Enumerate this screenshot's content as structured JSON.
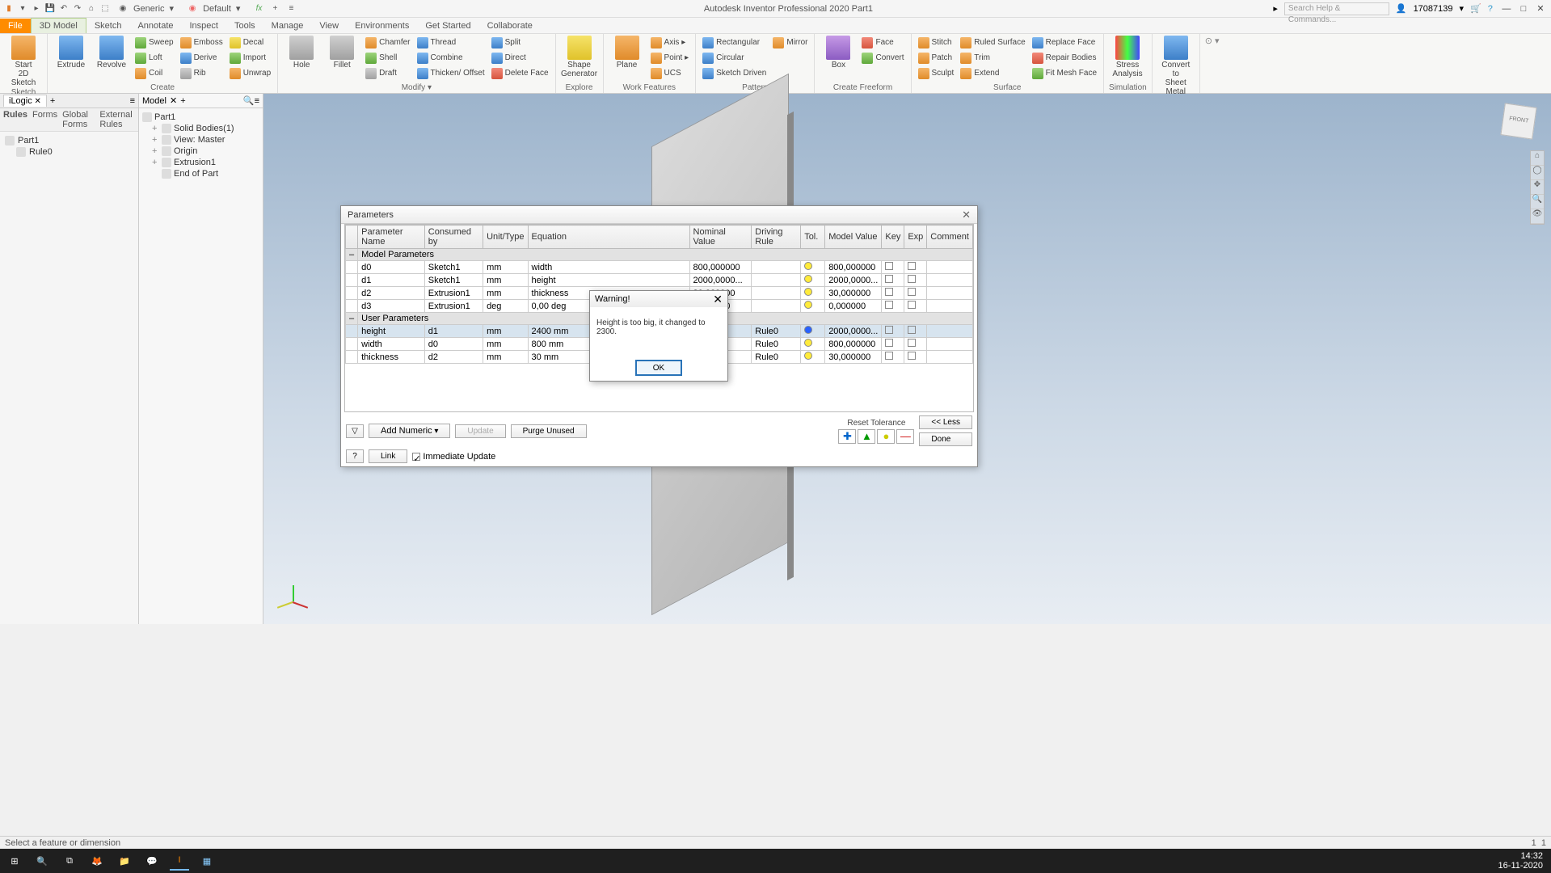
{
  "titlebar": {
    "material": "Generic",
    "appearance": "Default",
    "title": "Autodesk Inventor Professional 2020   Part1",
    "search_placeholder": "Search Help & Commands...",
    "user": "17087139"
  },
  "ribbon": {
    "tabs": [
      "File",
      "3D Model",
      "Sketch",
      "Annotate",
      "Inspect",
      "Tools",
      "Manage",
      "View",
      "Environments",
      "Get Started",
      "Collaborate"
    ],
    "active_tab": "3D Model",
    "groups": {
      "sketch": {
        "label": "Sketch",
        "start": "Start",
        "start2": "2D Sketch"
      },
      "create": {
        "label": "Create",
        "extrude": "Extrude",
        "revolve": "Revolve",
        "sweep": "Sweep",
        "loft": "Loft",
        "coil": "Coil",
        "emboss": "Emboss",
        "derive": "Derive",
        "rib": "Rib",
        "decal": "Decal",
        "import": "Import",
        "unwrap": "Unwrap"
      },
      "modify": {
        "label": "Modify ▾",
        "hole": "Hole",
        "fillet": "Fillet",
        "chamfer": "Chamfer",
        "shell": "Shell",
        "draft": "Draft",
        "thread": "Thread",
        "combine": "Combine",
        "thicken": "Thicken/ Offset",
        "split": "Split",
        "direct": "Direct",
        "delface": "Delete Face"
      },
      "explore": {
        "label": "Explore",
        "shape": "Shape",
        "gen": "Generator"
      },
      "workfeat": {
        "label": "Work Features",
        "plane": "Plane",
        "axis": "Axis  ▸",
        "point": "Point  ▸",
        "ucs": "UCS"
      },
      "pattern": {
        "label": "Pattern",
        "rect": "Rectangular",
        "circ": "Circular",
        "sketch": "Sketch Driven",
        "mirror": "Mirror"
      },
      "freeform": {
        "label": "Create Freeform",
        "box": "Box",
        "face": "Face",
        "convert": "Convert"
      },
      "surface": {
        "label": "Surface",
        "stitch": "Stitch",
        "patch": "Patch",
        "sculpt": "Sculpt",
        "ruled": "Ruled Surface",
        "trim": "Trim",
        "extend": "Extend",
        "replace": "Replace Face",
        "repair": "Repair Bodies",
        "fitmesh": "Fit Mesh Face"
      },
      "sim": {
        "label": "Simulation",
        "stress": "Stress",
        "analysis": "Analysis"
      },
      "convert": {
        "label": "Convert",
        "convto": "Convert to",
        "sheetm": "Sheet Metal"
      }
    }
  },
  "ilogic": {
    "tab": "iLogic",
    "subtabs": [
      "Rules",
      "Forms",
      "Global Forms",
      "External Rules"
    ],
    "tree": {
      "part": "Part1",
      "rule": "Rule0"
    }
  },
  "model": {
    "tab": "Model",
    "root": "Part1",
    "nodes": [
      "Solid Bodies(1)",
      "View: Master",
      "Origin",
      "Extrusion1",
      "End of Part"
    ]
  },
  "doctab": {
    "name": "Part1"
  },
  "status": {
    "prompt": "Select a feature or dimension",
    "r1": "1",
    "r2": "1"
  },
  "params": {
    "title": "Parameters",
    "headers": [
      "Parameter Name",
      "Consumed by",
      "Unit/Type",
      "Equation",
      "Nominal Value",
      "Driving Rule",
      "Tol.",
      "Model Value",
      "Key",
      "Exp",
      "Comment"
    ],
    "grp1": "Model Parameters",
    "rows": [
      {
        "name": "d0",
        "by": "Sketch1",
        "unit": "mm",
        "eq": "width",
        "nom": "800,000000",
        "drv": "",
        "tol": "y",
        "mv": "800,000000"
      },
      {
        "name": "d1",
        "by": "Sketch1",
        "unit": "mm",
        "eq": "height",
        "nom": "2000,0000...",
        "drv": "",
        "tol": "y",
        "mv": "2000,0000..."
      },
      {
        "name": "d2",
        "by": "Extrusion1",
        "unit": "mm",
        "eq": "thickness",
        "nom": "30,000000",
        "drv": "",
        "tol": "y",
        "mv": "30,000000"
      },
      {
        "name": "d3",
        "by": "Extrusion1",
        "unit": "deg",
        "eq": "0,00 deg",
        "nom": "0,000000",
        "drv": "",
        "tol": "y",
        "mv": "0,000000"
      }
    ],
    "grp2": "User Parameters",
    "urows": [
      {
        "name": "height",
        "by": "d1",
        "unit": "mm",
        "eq": "2400 mm",
        "nom": "",
        "drv": "Rule0",
        "tol": "b",
        "mv": "2000,0000...",
        "sel": true
      },
      {
        "name": "width",
        "by": "d0",
        "unit": "mm",
        "eq": "800 mm",
        "nom": "",
        "drv": "Rule0",
        "tol": "y",
        "mv": "800,000000"
      },
      {
        "name": "thickness",
        "by": "d2",
        "unit": "mm",
        "eq": "30 mm",
        "nom": "",
        "drv": "Rule0",
        "tol": "y",
        "mv": "30,000000"
      }
    ],
    "buttons": {
      "addnum": "Add Numeric",
      "update": "Update",
      "purge": "Purge Unused",
      "link": "Link",
      "immed": "Immediate Update",
      "reset": "Reset Tolerance",
      "less": "<< Less",
      "done": "Done"
    }
  },
  "warning": {
    "title": "Warning!",
    "message": "Height is too big, it changed to 2300.",
    "ok": "OK"
  },
  "taskbar": {
    "time": "14:32",
    "date": "16-11-2020"
  }
}
